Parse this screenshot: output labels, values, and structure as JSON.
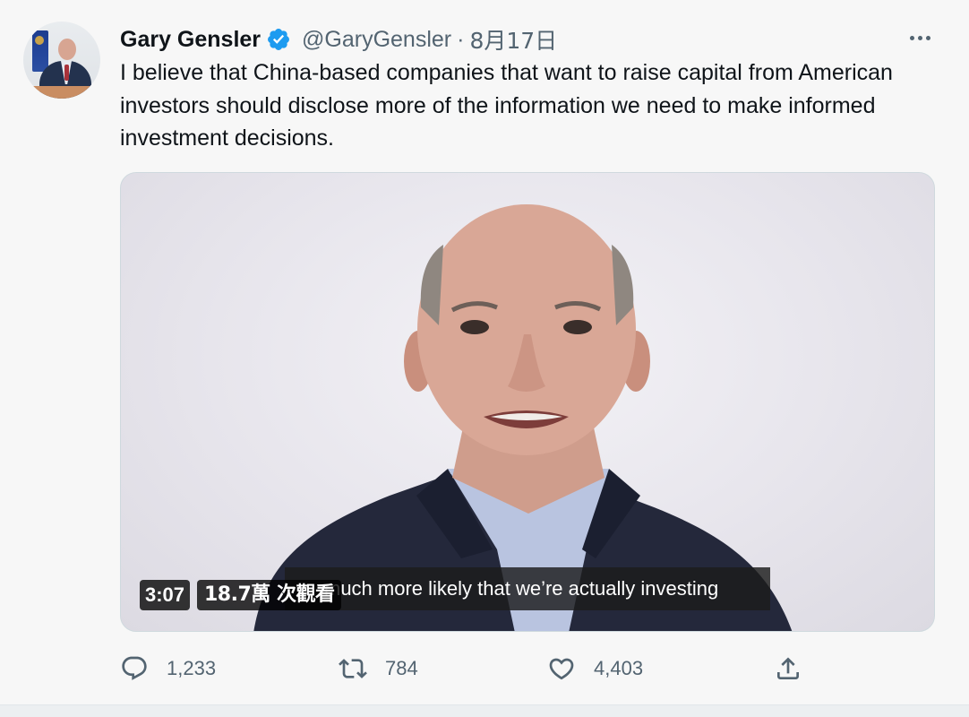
{
  "tweet": {
    "display_name": "Gary Gensler",
    "verified": true,
    "handle": "@GaryGensler",
    "separator": "·",
    "date": "8月17日",
    "text": "I believe that China-based companies that want to raise capital from American investors should disclose more of the information we need to make informed investment decisions."
  },
  "video": {
    "caption": "much more likely that we’re actually investing",
    "duration": "3:07",
    "views": "18.7萬 次觀看"
  },
  "actions": {
    "replies": "1,233",
    "retweets": "784",
    "likes": "4,403"
  },
  "icons": {
    "verified": "verified-badge-icon",
    "more": "more-options-icon",
    "reply": "reply-icon",
    "retweet": "retweet-icon",
    "like": "heart-icon",
    "share": "share-icon"
  },
  "colors": {
    "verified": "#1d9bf0",
    "secondary_text": "#536471",
    "primary_text": "#0f1419"
  }
}
